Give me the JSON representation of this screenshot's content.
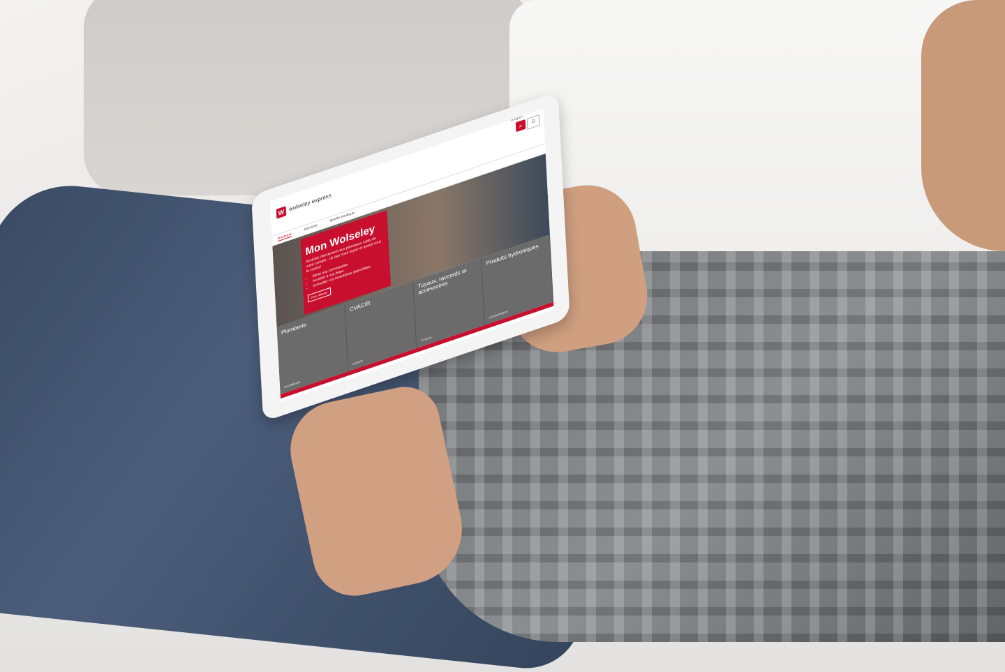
{
  "site": {
    "brand": "wolseley express",
    "header": {
      "language": "Région",
      "cart_label": "0"
    },
    "nav": [
      "Boutique",
      "Services",
      "Quelle boutique"
    ],
    "hero": {
      "title": "Mon Wolseley",
      "body": "Accédez directement aux principaux outils de votre compte - où que vous soyez et quand vous le voulez!",
      "bullets": [
        "Gérer vos commandes",
        "Accéder à vos listes",
        "Consulter vos inventaires disponibles"
      ],
      "cta": "Pour débuter"
    },
    "categories": [
      {
        "name": "Plomberie",
        "more": "PLOMBERIE"
      },
      {
        "name": "CVAC/R",
        "more": "CVAC/R"
      },
      {
        "name": "Tuyaux, raccords et accessoires",
        "more": "TUYAUX"
      },
      {
        "name": "Produits hydroniques",
        "more": "HYDRONIQUE"
      }
    ]
  },
  "colors": {
    "brand_red": "#c8102e",
    "category_gray": "#6b6b6b"
  }
}
